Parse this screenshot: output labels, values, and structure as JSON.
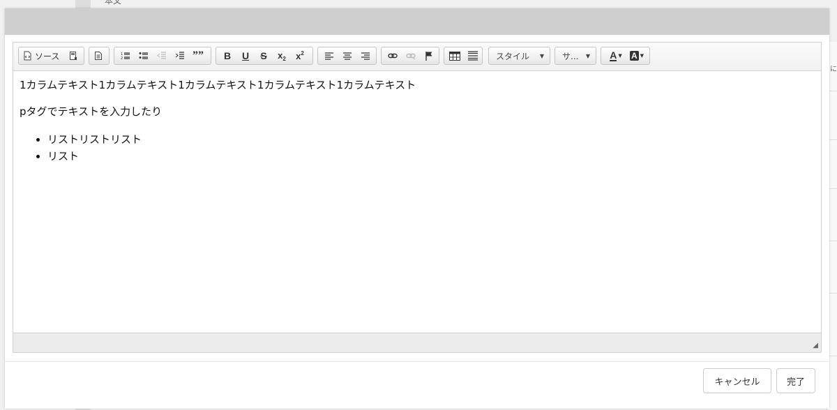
{
  "background": {
    "partial_text": "本文",
    "right_char": "に"
  },
  "toolbar": {
    "source_label": "ソース",
    "style_combo": "スタイル",
    "size_combo": "サ..."
  },
  "content": {
    "paragraph1": "1カラムテキスト1カラムテキスト1カラムテキスト1カラムテキスト1カラムテキスト",
    "paragraph2": "pタグでテキストを入力したり",
    "list": [
      "リストリストリスト",
      "リスト"
    ]
  },
  "footer": {
    "cancel_label": "キャンセル",
    "done_label": "完了"
  },
  "icons": {
    "source": "source-icon",
    "maximize": "maximize-icon",
    "template": "document-icon",
    "ordered_list": "numbered-list-icon",
    "bulleted_list": "bulleted-list-icon",
    "outdent": "outdent-icon",
    "indent": "indent-icon",
    "blockquote": "blockquote-icon",
    "bold": "bold-icon",
    "underline": "underline-icon",
    "strike": "strikethrough-icon",
    "subscript": "subscript-icon",
    "superscript": "superscript-icon",
    "align_left": "align-left-icon",
    "align_center": "align-center-icon",
    "align_right": "align-right-icon",
    "link": "link-icon",
    "unlink": "unlink-icon",
    "anchor": "flag-icon",
    "table": "table-icon",
    "hr": "horizontal-line-icon",
    "text_color": "text-color-icon",
    "bg_color": "background-color-icon"
  }
}
